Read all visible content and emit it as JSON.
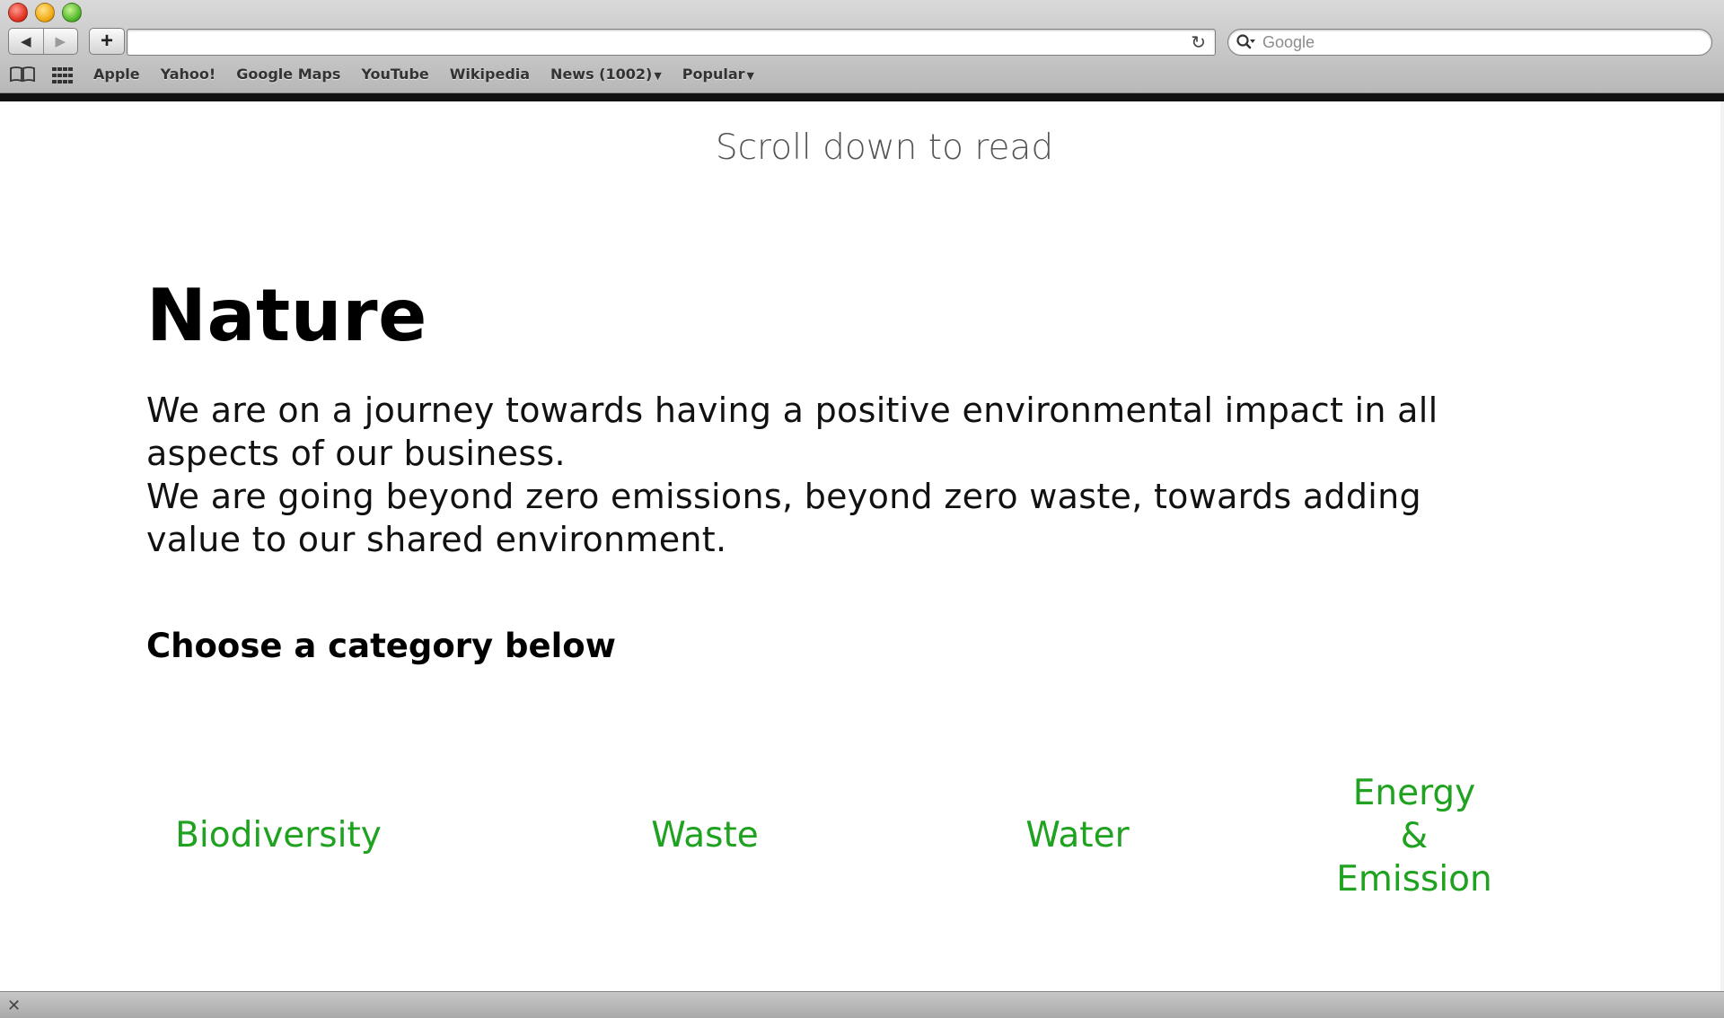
{
  "browser": {
    "url": "",
    "search_placeholder": "Google",
    "bookmarks": [
      {
        "label": "Apple"
      },
      {
        "label": "Yahoo!"
      },
      {
        "label": "Google Maps"
      },
      {
        "label": "YouTube"
      },
      {
        "label": "Wikipedia"
      },
      {
        "label": "News (1002)",
        "has_menu": true
      },
      {
        "label": "Popular",
        "has_menu": true
      }
    ]
  },
  "page": {
    "scroll_hint": "Scroll down to read",
    "title": "Nature",
    "intro": [
      "We are on a journey towards having a positive environmental impact in all aspects of our business.",
      "We are going beyond zero emissions, beyond zero waste, towards adding value to our shared environment."
    ],
    "choose_label": "Choose a category below",
    "categories": [
      {
        "label": "Biodiversity"
      },
      {
        "label": "Waste"
      },
      {
        "label": "Water"
      },
      {
        "label": "Energy\n&\nEmission"
      }
    ],
    "category_color": "#1fa21f"
  }
}
